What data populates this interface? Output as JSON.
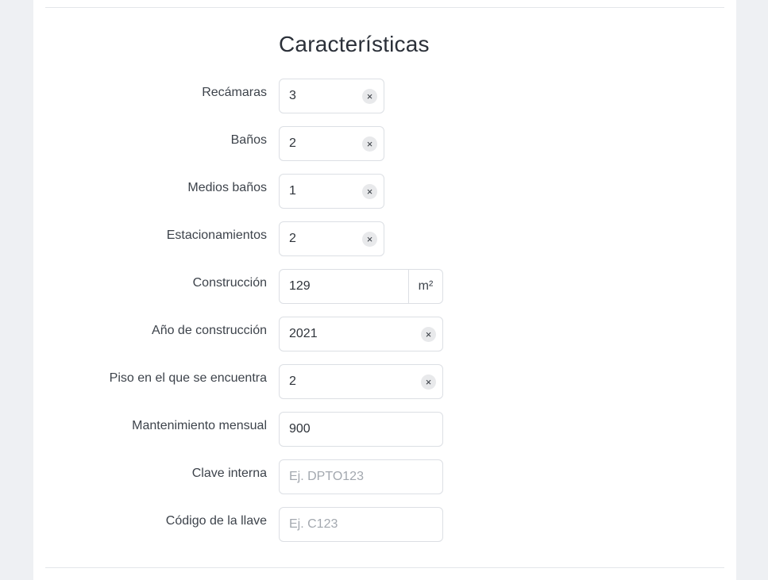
{
  "section": {
    "title": "Características"
  },
  "fields": {
    "recamaras": {
      "label": "Recámaras",
      "value": "3"
    },
    "banos": {
      "label": "Baños",
      "value": "2"
    },
    "medios_banos": {
      "label": "Medios baños",
      "value": "1"
    },
    "estacionamientos": {
      "label": "Estacionamientos",
      "value": "2"
    },
    "construccion": {
      "label": "Construcción",
      "value": "129",
      "unit": "m²"
    },
    "anio_construccion": {
      "label": "Año de construcción",
      "value": "2021"
    },
    "piso": {
      "label": "Piso en el que se encuentra",
      "value": "2"
    },
    "mantenimiento": {
      "label": "Mantenimiento mensual",
      "value": "900"
    },
    "clave_interna": {
      "label": "Clave interna",
      "value": "",
      "placeholder": "Ej. DPTO123"
    },
    "codigo_llave": {
      "label": "Código de la llave",
      "value": "",
      "placeholder": "Ej. C123"
    }
  },
  "icons": {
    "clear": "close-icon",
    "clear_glyph": "×"
  }
}
